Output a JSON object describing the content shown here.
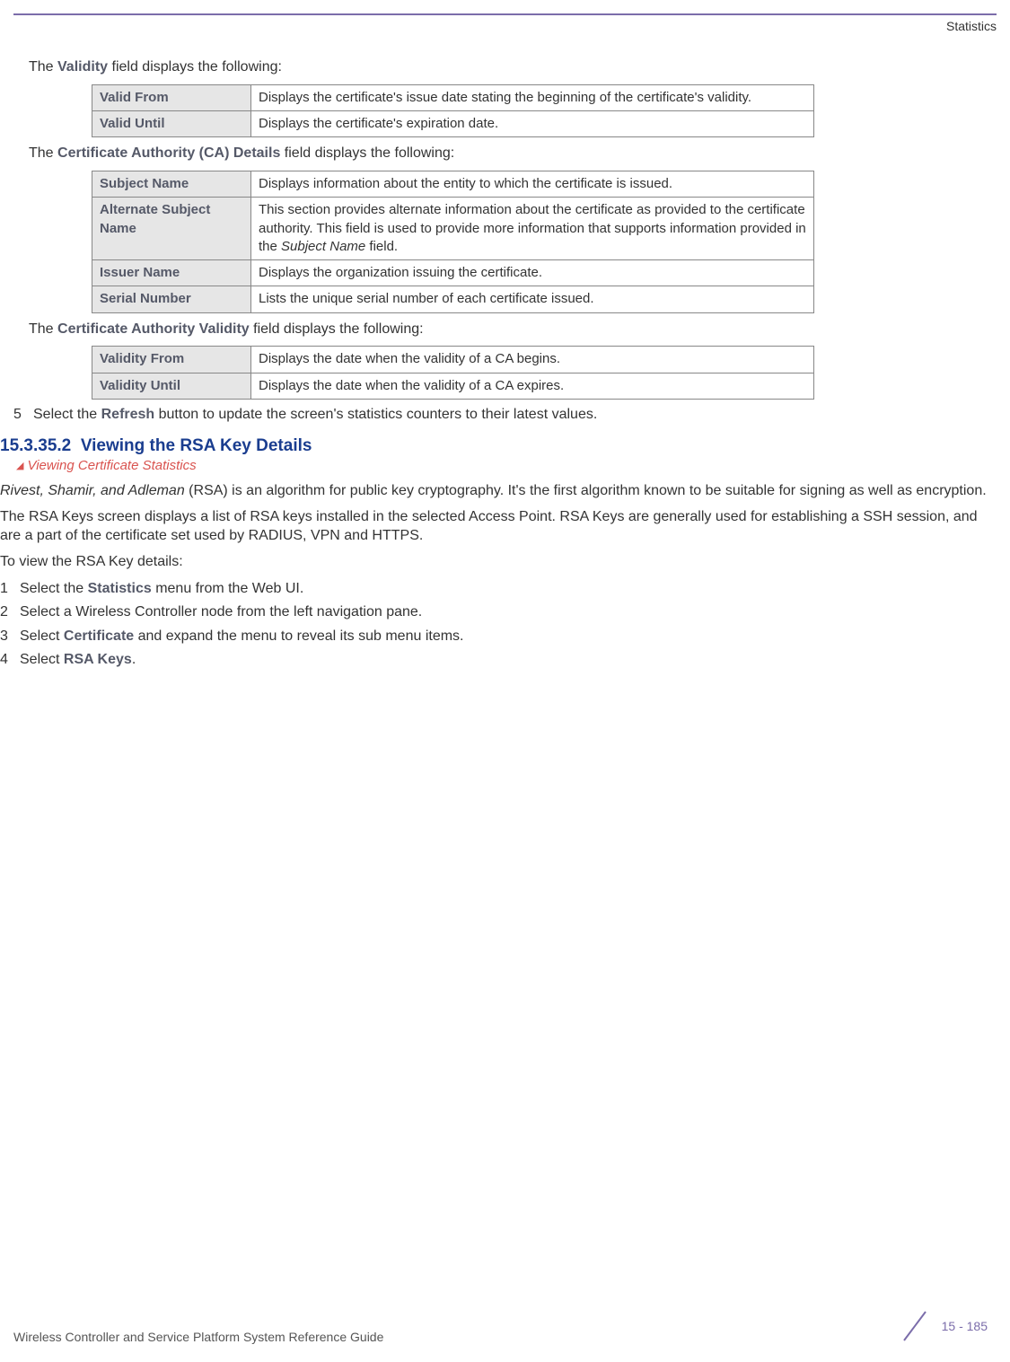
{
  "header": {
    "section_name": "Statistics"
  },
  "intro1": {
    "prefix": "The ",
    "bold": "Validity",
    "suffix": " field displays the following:"
  },
  "table1": [
    {
      "label": "Valid From",
      "desc": "Displays the certificate's issue date stating the beginning of the certificate's validity."
    },
    {
      "label": "Valid Until",
      "desc": "Displays the certificate's expiration date."
    }
  ],
  "intro2": {
    "prefix": "The ",
    "bold": "Certificate Authority (CA) Details",
    "suffix": " field displays the following:"
  },
  "table2": [
    {
      "label": "Subject Name",
      "desc": "Displays information about the entity to which the certificate is issued."
    },
    {
      "label": "Alternate Subject Name",
      "desc_pre": "This section provides alternate information about the certificate as provided to the certificate authority. This field is used to provide more information that supports information provided in the ",
      "desc_italic": "Subject Name",
      "desc_post": " field."
    },
    {
      "label": "Issuer Name",
      "desc": "Displays the organization issuing the certificate."
    },
    {
      "label": "Serial Number",
      "desc": "Lists the unique serial number of each certificate issued."
    }
  ],
  "intro3": {
    "prefix": "The ",
    "bold": "Certificate Authority Validity",
    "suffix": " field displays the following:"
  },
  "table3": [
    {
      "label": "Validity From",
      "desc": "Displays the date when the validity of a CA begins."
    },
    {
      "label": "Validity Until",
      "desc": "Displays the date when the validity of a CA expires."
    }
  ],
  "step5": {
    "num": "5",
    "pre": "Select the ",
    "bold": "Refresh",
    "post": " button to update the screen's statistics counters to their latest values."
  },
  "section": {
    "number": "15.3.35.2",
    "title": "Viewing the RSA Key Details"
  },
  "breadcrumb": "Viewing Certificate Statistics",
  "para1": {
    "italic": "Rivest, Shamir, and Adleman",
    "rest": " (RSA) is an algorithm for public key cryptography. It's the first algorithm known to be suitable for signing as well as encryption."
  },
  "para2": "The RSA Keys screen displays a list of RSA keys installed in the selected Access Point. RSA Keys are generally used for establishing a SSH session, and are a part of the certificate set used by RADIUS, VPN and HTTPS.",
  "para3": "To view the RSA Key details:",
  "steps": [
    {
      "num": "1",
      "pre": "Select the ",
      "bold": "Statistics",
      "post": " menu from the Web UI."
    },
    {
      "num": "2",
      "plain": "Select a Wireless Controller node from the left navigation pane."
    },
    {
      "num": "3",
      "pre": "Select ",
      "bold": "Certificate",
      "post": " and expand the menu to reveal its sub menu items."
    },
    {
      "num": "4",
      "pre": "Select ",
      "bold": "RSA Keys",
      "post": "."
    }
  ],
  "footer": {
    "left": "Wireless Controller and Service Platform System Reference Guide",
    "right": "15 - 185"
  }
}
